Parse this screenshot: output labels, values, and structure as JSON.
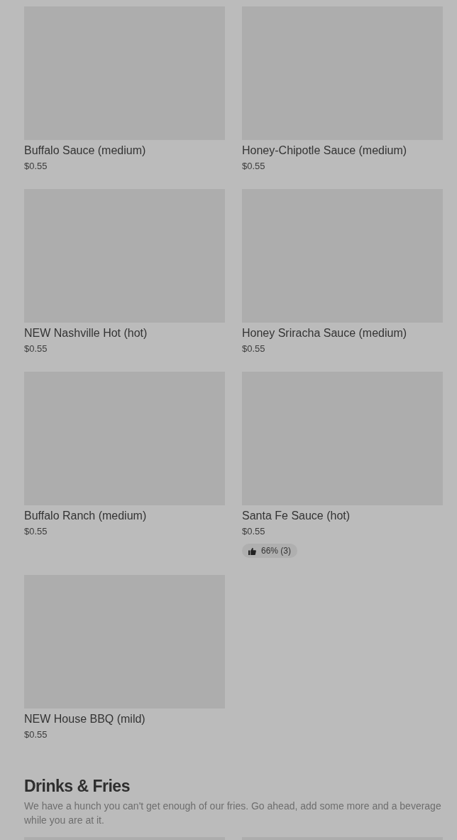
{
  "sections": [
    {
      "items": [
        {
          "kind": "product",
          "name": "Buffalo Sauce (medium)",
          "price": "$0.55"
        },
        {
          "kind": "product",
          "name": "Honey-Chipotle Sauce (medium)",
          "price": "$0.55"
        },
        {
          "kind": "product",
          "name": "NEW Nashville Hot (hot)",
          "price": "$0.55"
        },
        {
          "kind": "product",
          "name": "Honey Sriracha Sauce (medium)",
          "price": "$0.55"
        },
        {
          "kind": "product",
          "name": "Buffalo Ranch (medium)",
          "price": "$0.55"
        },
        {
          "kind": "product",
          "name": "Santa Fe Sauce (hot)",
          "price": "$0.55",
          "rating": "66% (3)"
        },
        {
          "kind": "product",
          "name": "NEW House BBQ (mild)",
          "price": "$0.55"
        }
      ]
    },
    {
      "title": "Drinks & Fries",
      "description": "We have a hunch you can't get enough of our fries. Go ahead, add some more and a beverage while you are at it."
    }
  ]
}
